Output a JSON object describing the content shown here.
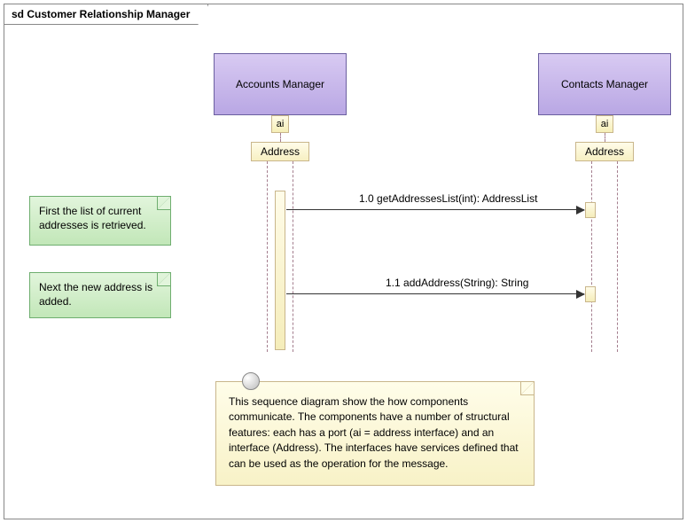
{
  "frame": {
    "title": "sd Customer Relationship Manager"
  },
  "lifelines": {
    "accounts": {
      "name": "Accounts Manager",
      "port": "ai",
      "interface": "Address"
    },
    "contacts": {
      "name": "Contacts Manager",
      "port": "ai",
      "interface": "Address"
    }
  },
  "messages": {
    "m1": {
      "label": "1.0 getAddressesList(int): AddressList"
    },
    "m2": {
      "label": "1.1 addAddress(String): String"
    }
  },
  "notes": {
    "n1": {
      "text": "First the list of current addresses is retrieved."
    },
    "n2": {
      "text": "Next the new address is added."
    },
    "n3": {
      "text": "This sequence diagram show the how components communicate. The components have a number of structural features: each has a port (ai = address interface) and an interface (Address). The interfaces have services defined that can be used as the operation for the message."
    }
  }
}
